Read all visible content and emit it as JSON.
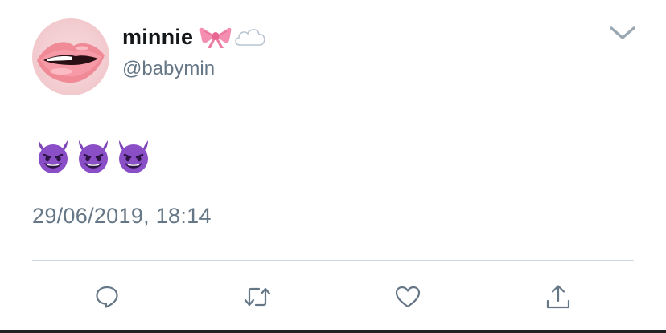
{
  "tweet": {
    "display_name": "minnie",
    "name_emojis": [
      "ribbon",
      "cloud"
    ],
    "handle": "@babymin",
    "text_emojis": [
      "smiling-face-with-horns",
      "smiling-face-with-horns",
      "smiling-face-with-horns"
    ],
    "timestamp": "29/06/2019, 18:14"
  },
  "actions": [
    {
      "name": "reply",
      "icon": "reply-icon"
    },
    {
      "name": "retweet",
      "icon": "retweet-icon"
    },
    {
      "name": "like",
      "icon": "heart-icon"
    },
    {
      "name": "share",
      "icon": "share-icon"
    }
  ],
  "colors": {
    "text_primary": "#14171a",
    "text_secondary": "#657786",
    "divider": "#cfd9de",
    "icon": "#657786",
    "devil_purple": "#8a4fc7"
  }
}
